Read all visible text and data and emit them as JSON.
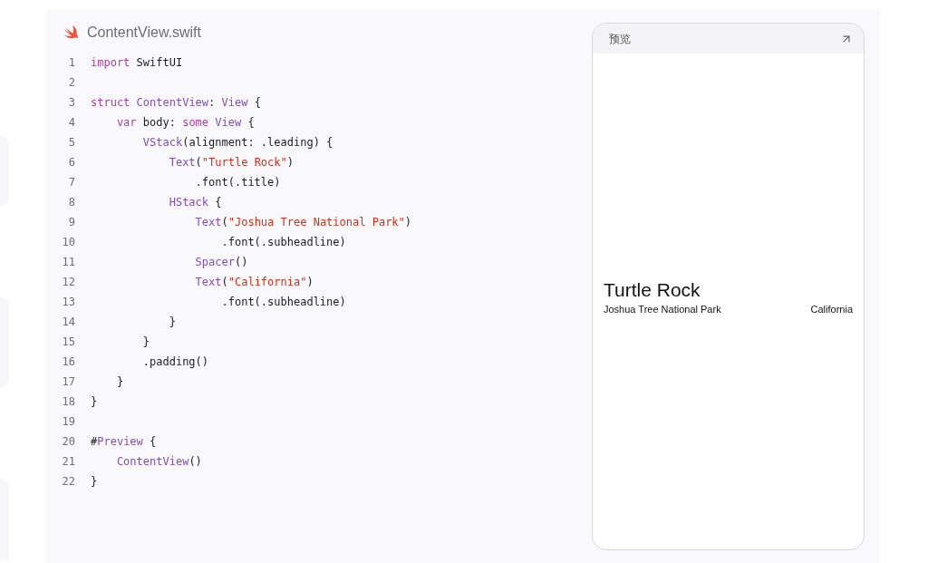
{
  "file": {
    "name": "ContentView.swift"
  },
  "code": {
    "lines": [
      {
        "number": "1",
        "tokens": [
          {
            "kind": "keyword",
            "text": "import"
          },
          {
            "kind": "plain",
            "text": " SwiftUI"
          }
        ]
      },
      {
        "number": "2"
      },
      {
        "number": "3",
        "tokens": [
          {
            "kind": "keyword",
            "text": "struct"
          },
          {
            "kind": "type",
            "text": " ContentView"
          },
          {
            "kind": "plain",
            "text": ": "
          },
          {
            "kind": "type",
            "text": "View"
          },
          {
            "kind": "plain",
            "text": " {"
          }
        ]
      },
      {
        "number": "4",
        "tokens": [
          {
            "kind": "keyword",
            "text": "    var"
          },
          {
            "kind": "plain",
            "text": " body: "
          },
          {
            "kind": "keyword",
            "text": "some"
          },
          {
            "kind": "type",
            "text": " View"
          },
          {
            "kind": "plain",
            "text": " {"
          }
        ]
      },
      {
        "number": "5",
        "tokens": [
          {
            "kind": "type",
            "text": "        VStack"
          },
          {
            "kind": "plain",
            "text": "(alignment: .leading) {"
          }
        ]
      },
      {
        "number": "6",
        "tokens": [
          {
            "kind": "type",
            "text": "            Text"
          },
          {
            "kind": "plain",
            "text": "("
          },
          {
            "kind": "string",
            "text": "\"Turtle Rock\""
          },
          {
            "kind": "plain",
            "text": ")"
          }
        ]
      },
      {
        "number": "7",
        "tokens": [
          {
            "kind": "plain",
            "text": "                .font(.title)"
          }
        ]
      },
      {
        "number": "8",
        "tokens": [
          {
            "kind": "type",
            "text": "            HStack"
          },
          {
            "kind": "plain",
            "text": " {"
          }
        ]
      },
      {
        "number": "9",
        "tokens": [
          {
            "kind": "type",
            "text": "                Text"
          },
          {
            "kind": "plain",
            "text": "("
          },
          {
            "kind": "string",
            "text": "\"Joshua Tree National Park\""
          },
          {
            "kind": "plain",
            "text": ")"
          }
        ]
      },
      {
        "number": "10",
        "tokens": [
          {
            "kind": "plain",
            "text": "                    .font(.subheadline)"
          }
        ]
      },
      {
        "number": "11",
        "tokens": [
          {
            "kind": "type",
            "text": "                Spacer"
          },
          {
            "kind": "plain",
            "text": "()"
          }
        ]
      },
      {
        "number": "12",
        "tokens": [
          {
            "kind": "type",
            "text": "                Text"
          },
          {
            "kind": "plain",
            "text": "("
          },
          {
            "kind": "string",
            "text": "\"California\""
          },
          {
            "kind": "plain",
            "text": ")"
          }
        ]
      },
      {
        "number": "13",
        "tokens": [
          {
            "kind": "plain",
            "text": "                    .font(.subheadline)"
          }
        ]
      },
      {
        "number": "14",
        "tokens": [
          {
            "kind": "plain",
            "text": "            }"
          }
        ]
      },
      {
        "number": "15",
        "tokens": [
          {
            "kind": "plain",
            "text": "        }"
          }
        ]
      },
      {
        "number": "16",
        "tokens": [
          {
            "kind": "plain",
            "text": "        .padding()"
          }
        ]
      },
      {
        "number": "17",
        "tokens": [
          {
            "kind": "plain",
            "text": "    }"
          }
        ]
      },
      {
        "number": "18",
        "tokens": [
          {
            "kind": "plain",
            "text": "}"
          }
        ]
      },
      {
        "number": "19"
      },
      {
        "number": "20",
        "tokens": [
          {
            "kind": "plain",
            "text": "#"
          },
          {
            "kind": "type",
            "text": "Preview"
          },
          {
            "kind": "plain",
            "text": " {"
          }
        ]
      },
      {
        "number": "21",
        "tokens": [
          {
            "kind": "type",
            "text": "    ContentView"
          },
          {
            "kind": "plain",
            "text": "()"
          }
        ]
      },
      {
        "number": "22",
        "tokens": [
          {
            "kind": "plain",
            "text": "}"
          }
        ]
      }
    ]
  },
  "preview": {
    "title": "预览",
    "content": {
      "title": "Turtle Rock",
      "subtitle": "Joshua Tree National Park",
      "location": "California"
    }
  }
}
